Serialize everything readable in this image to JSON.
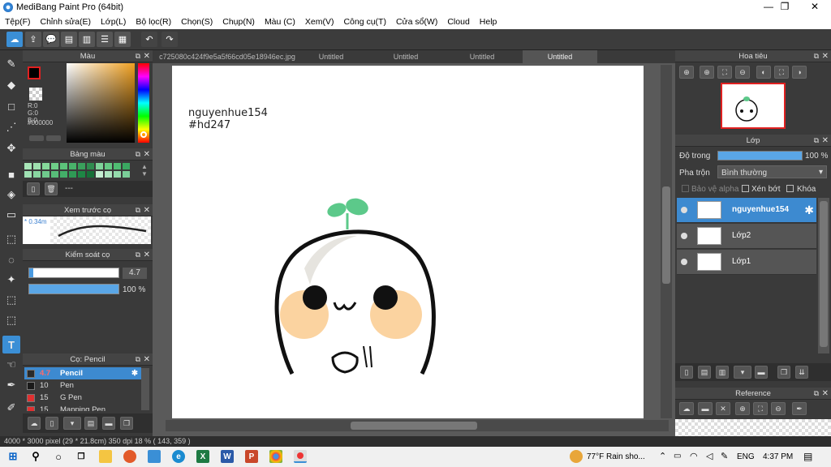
{
  "app": {
    "title": "MediBang Paint Pro (64bit)"
  },
  "window": {
    "minimize": "—",
    "maximize": "❐",
    "close": "✕"
  },
  "menu": [
    "Tệp(F)",
    "Chỉnh sửa(E)",
    "Lớp(L)",
    "Bộ lọc(R)",
    "Chọn(S)",
    "Chụp(N)",
    "Màu (C)",
    "Xem(V)",
    "Công cụ(T)",
    "Cửa sổ(W)",
    "Cloud",
    "Help"
  ],
  "toolbar": {
    "undo": "↶",
    "redo": "↷"
  },
  "tabs": [
    {
      "label": "c725080c424f9e5a5f66cd05e18946ec.jpg",
      "active": false
    },
    {
      "label": "Untitled",
      "active": false
    },
    {
      "label": "Untitled",
      "active": false
    },
    {
      "label": "Untitled",
      "active": false
    },
    {
      "label": "Untitled",
      "active": true
    }
  ],
  "color_panel": {
    "title": "Màu",
    "r": "R:0",
    "g": "G:0",
    "b": "B:0",
    "hex": "#000000"
  },
  "palette_panel": {
    "title": "Bảng màu",
    "dash": "---",
    "colors": [
      "#a8e6b8",
      "#9ee0ae",
      "#86d99a",
      "#6fcf88",
      "#5cc27a",
      "#49b36a",
      "#3aa05c",
      "#2f8c4f",
      "#7fd49a",
      "#66c985",
      "#4fbd72",
      "#3aa861",
      "#a0e2b4",
      "#88d6a0",
      "#6fca8c",
      "#58bd79",
      "#43ae68",
      "#2f9a55",
      "#1e8645",
      "#167038",
      "#c6efd3",
      "#aee5c0",
      "#94dbac",
      "#7ace98"
    ]
  },
  "brush_preview": {
    "title": "Xem trước cọ",
    "size": "* 0.34m"
  },
  "brush_control": {
    "title": "Kiểm soát cọ",
    "size": "4.7",
    "opacity": "100 %",
    "size_fraction": 0.047,
    "opacity_fraction": 1.0
  },
  "brush_list": {
    "title": "Cọ: Pencil",
    "items": [
      {
        "size": "4.7",
        "name": "Pencil",
        "selected": true,
        "swatch": "#2a2a2a"
      },
      {
        "size": "10",
        "name": "Pen",
        "selected": false,
        "swatch": "#1a1a1a"
      },
      {
        "size": "15",
        "name": "G Pen",
        "selected": false,
        "swatch": "#e03030"
      },
      {
        "size": "15",
        "name": "Mapping Pen",
        "selected": false,
        "swatch": "#e03030"
      }
    ]
  },
  "canvas": {
    "text_line1": "nguyenhue154",
    "text_line2": "#hd247"
  },
  "navigator": {
    "title": "Hoa tiêu"
  },
  "layer_panel": {
    "title": "Lớp",
    "opacity_label": "Độ trong",
    "opacity_value": "100 %",
    "opacity_fraction": 1.0,
    "blend_label": "Pha trộn",
    "blend_value": "Bình thường",
    "protect_alpha": "Bảo vệ alpha",
    "clipping": "Xén bớt",
    "lock": "Khóa",
    "layers": [
      {
        "name": "nguyenhue154",
        "selected": true
      },
      {
        "name": "Lớp2",
        "selected": false
      },
      {
        "name": "Lớp1",
        "selected": false
      }
    ]
  },
  "reference_panel": {
    "title": "Reference"
  },
  "status": {
    "text": "4000 * 3000 pixel   (29 * 21.8cm)   350 dpi   18 %   ( 143, 359 )"
  },
  "taskbar": {
    "weather": "77°F  Rain sho...",
    "lang": "ENG",
    "time": "4:37 PM"
  }
}
